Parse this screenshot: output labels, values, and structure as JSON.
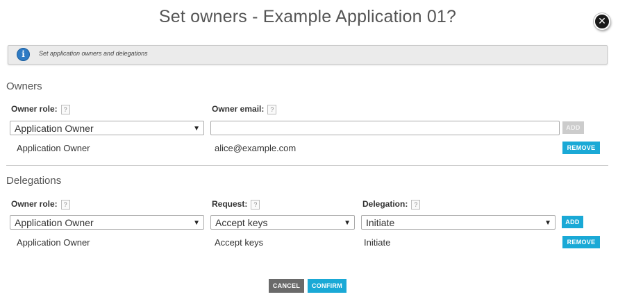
{
  "dialog": {
    "title": "Set owners - Example Application 01?",
    "close_glyph": "✕"
  },
  "info": {
    "icon_glyph": "i",
    "text": "Set application owners and delegations"
  },
  "owners": {
    "title": "Owners",
    "role_label": "Owner role:",
    "email_label": "Owner email:",
    "help_glyph": "?",
    "role_select": "Application Owner",
    "email_value": "",
    "add_label": "ADD",
    "rows": [
      {
        "role": "Application Owner",
        "email": "alice@example.com",
        "remove_label": "REMOVE"
      }
    ]
  },
  "delegations": {
    "title": "Delegations",
    "role_label": "Owner role:",
    "request_label": "Request:",
    "delegation_label": "Delegation:",
    "help_glyph": "?",
    "role_select": "Application Owner",
    "request_select": "Accept keys",
    "delegation_select": "Initiate",
    "add_label": "ADD",
    "rows": [
      {
        "role": "Application Owner",
        "request": "Accept keys",
        "delegation": "Initiate",
        "remove_label": "REMOVE"
      }
    ]
  },
  "footer": {
    "cancel_label": "CANCEL",
    "confirm_label": "CONFIRM"
  },
  "colors": {
    "accent": "#1aa9d6",
    "info_icon": "#2e7bc4",
    "cancel": "#6a6a6a"
  }
}
